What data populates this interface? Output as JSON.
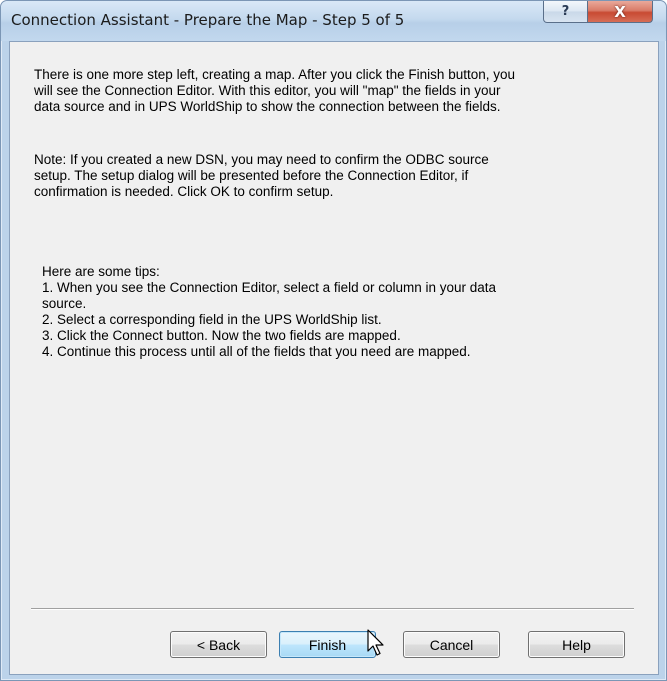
{
  "window": {
    "title": "Connection Assistant - Prepare the Map - Step 5 of 5",
    "help_glyph": "?",
    "close_glyph": "X"
  },
  "body": {
    "paragraph1": "There is one more step left, creating a map. After you click the Finish button, you\nwill see the Connection Editor. With this editor, you will  \"map\" the fields in your\ndata source and in UPS WorldShip to show the connection between the fields.",
    "paragraph2": "Note: If you created a new DSN, you may need to confirm the ODBC source\nsetup. The setup dialog will be presented before the Connection Editor, if\nconfirmation is needed.  Click OK to confirm setup.",
    "tips_heading": "Here are some tips:",
    "tips": [
      "1. When you see the Connection Editor, select a field or column in your data\nsource.",
      "2. Select a corresponding field in the  UPS WorldShip list.",
      "3. Click the Connect button. Now the two fields are mapped.",
      "4. Continue this process until all of the fields that you need are mapped."
    ]
  },
  "buttons": {
    "back": "< Back",
    "finish": "Finish",
    "cancel": "Cancel",
    "help": "Help"
  },
  "icons": {
    "cursor": "arrow-pointer-icon"
  }
}
